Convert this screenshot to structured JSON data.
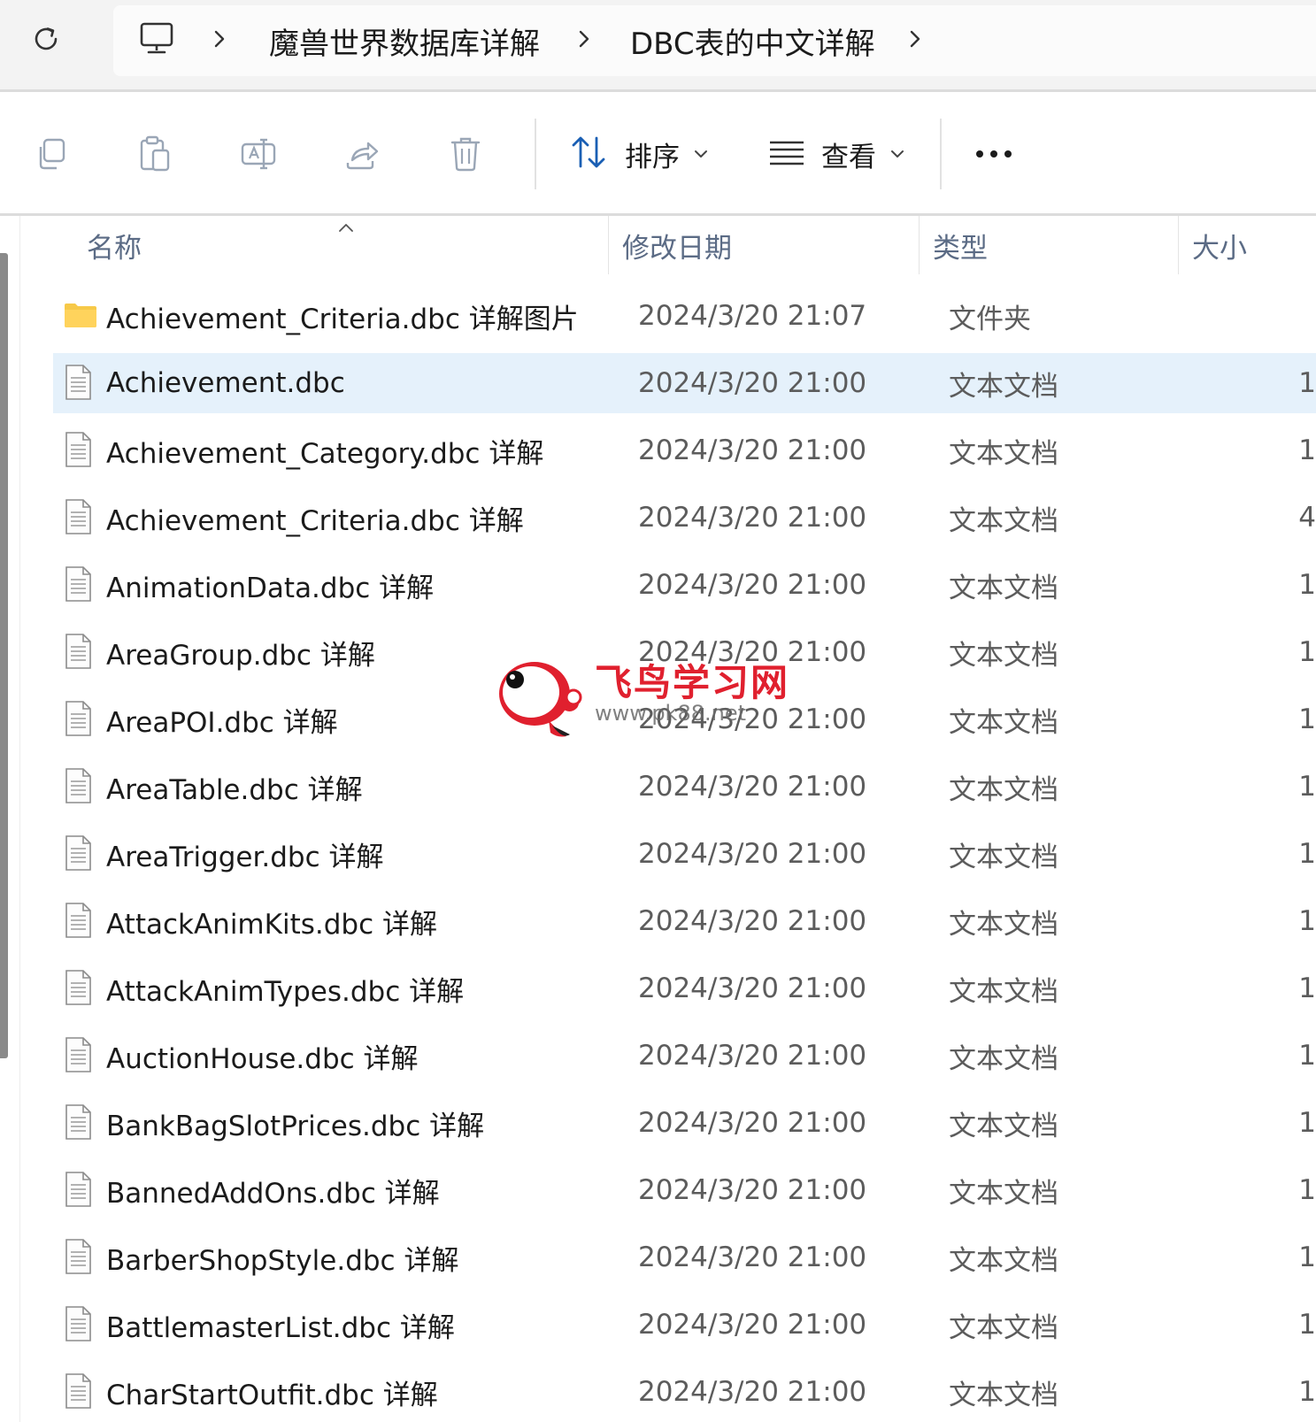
{
  "address": {
    "computer_icon": "computer-icon",
    "breadcrumbs": [
      "魔兽世界数据库详解",
      "DBC表的中文详解"
    ]
  },
  "toolbar": {
    "sort_label": "排序",
    "view_label": "查看"
  },
  "columns": {
    "name": "名称",
    "date": "修改日期",
    "type": "类型",
    "size": "大小"
  },
  "rows": [
    {
      "name": "Achievement_Criteria.dbc 详解图片",
      "date": "2024/3/20 21:07",
      "type": "文件夹",
      "size": "",
      "icon": "folder-icon",
      "selected": false
    },
    {
      "name": "Achievement.dbc",
      "date": "2024/3/20 21:00",
      "type": "文本文档",
      "size": "1",
      "icon": "text-file-icon",
      "selected": true
    },
    {
      "name": "Achievement_Category.dbc 详解",
      "date": "2024/3/20 21:00",
      "type": "文本文档",
      "size": "1",
      "icon": "text-file-icon",
      "selected": false
    },
    {
      "name": "Achievement_Criteria.dbc 详解",
      "date": "2024/3/20 21:00",
      "type": "文本文档",
      "size": "4",
      "icon": "text-file-icon",
      "selected": false
    },
    {
      "name": "AnimationData.dbc 详解",
      "date": "2024/3/20 21:00",
      "type": "文本文档",
      "size": "1",
      "icon": "text-file-icon",
      "selected": false
    },
    {
      "name": "AreaGroup.dbc 详解",
      "date": "2024/3/20 21:00",
      "type": "文本文档",
      "size": "1",
      "icon": "text-file-icon",
      "selected": false
    },
    {
      "name": "AreaPOI.dbc 详解",
      "date": "2024/3/20 21:00",
      "type": "文本文档",
      "size": "1",
      "icon": "text-file-icon",
      "selected": false
    },
    {
      "name": "AreaTable.dbc 详解",
      "date": "2024/3/20 21:00",
      "type": "文本文档",
      "size": "1",
      "icon": "text-file-icon",
      "selected": false
    },
    {
      "name": "AreaTrigger.dbc 详解",
      "date": "2024/3/20 21:00",
      "type": "文本文档",
      "size": "1",
      "icon": "text-file-icon",
      "selected": false
    },
    {
      "name": "AttackAnimKits.dbc 详解",
      "date": "2024/3/20 21:00",
      "type": "文本文档",
      "size": "1",
      "icon": "text-file-icon",
      "selected": false
    },
    {
      "name": "AttackAnimTypes.dbc 详解",
      "date": "2024/3/20 21:00",
      "type": "文本文档",
      "size": "1",
      "icon": "text-file-icon",
      "selected": false
    },
    {
      "name": "AuctionHouse.dbc 详解",
      "date": "2024/3/20 21:00",
      "type": "文本文档",
      "size": "1",
      "icon": "text-file-icon",
      "selected": false
    },
    {
      "name": "BankBagSlotPrices.dbc 详解",
      "date": "2024/3/20 21:00",
      "type": "文本文档",
      "size": "1",
      "icon": "text-file-icon",
      "selected": false
    },
    {
      "name": "BannedAddOns.dbc 详解",
      "date": "2024/3/20 21:00",
      "type": "文本文档",
      "size": "1",
      "icon": "text-file-icon",
      "selected": false
    },
    {
      "name": "BarberShopStyle.dbc 详解",
      "date": "2024/3/20 21:00",
      "type": "文本文档",
      "size": "1",
      "icon": "text-file-icon",
      "selected": false
    },
    {
      "name": "BattlemasterList.dbc 详解",
      "date": "2024/3/20 21:00",
      "type": "文本文档",
      "size": "1",
      "icon": "text-file-icon",
      "selected": false
    },
    {
      "name": "CharStartOutfit.dbc 详解",
      "date": "2024/3/20 21:00",
      "type": "文本文档",
      "size": "1",
      "icon": "text-file-icon",
      "selected": false
    }
  ],
  "watermark": {
    "title": "飞鸟学习网",
    "url": "www.pk88.net"
  },
  "colors": {
    "selection": "#e5f1fb",
    "folder": "#f7c948",
    "header_text": "#5b6b85",
    "watermark_red": "#e0202e"
  }
}
